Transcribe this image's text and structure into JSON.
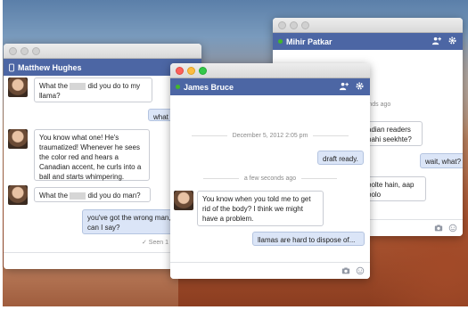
{
  "windows": {
    "mihir": {
      "title": "Mihir Patkar",
      "partial_lines": [
        "conds ago",
        "adian readers",
        "nahi seekhte?",
        "wait, what?",
        "bolte hain, aap",
        "bolo"
      ]
    },
    "matthew": {
      "title": "Matthew Hughes",
      "messages": [
        {
          "before": "What the ",
          "after": " did you do to my llama?"
        },
        {
          "text": "what ha"
        },
        {
          "text": "You know what one! He's traumatized! Whenever he sees the color red and hears a Canadian accent, he curls into a ball and starts whimpering."
        },
        {
          "before": "What the ",
          "after": " did you do man?"
        },
        {
          "text": "you've got the wrong man, can I say?"
        }
      ],
      "seen": "✓ Seen 1"
    },
    "james": {
      "title": "James Bruce",
      "timestamp1": "December 5, 2012 2:05 pm",
      "msg1": "draft ready.",
      "timestamp2": "a few seconds ago",
      "msg2": "You know when you told me to get rid of the body? I think we might have a problem.",
      "msg3": "llamas are hard to dispose of..."
    }
  },
  "icons": {
    "add_friend": "add-friend-icon",
    "settings": "gear-icon",
    "camera": "camera-icon",
    "emoji": "smiley-icon",
    "mobile": "mobile-phone-icon",
    "online": "online-dot-icon"
  },
  "colors": {
    "header_blue": "#4c66a4",
    "online_green": "#42b72a",
    "my_bubble": "#dbe5f7"
  }
}
